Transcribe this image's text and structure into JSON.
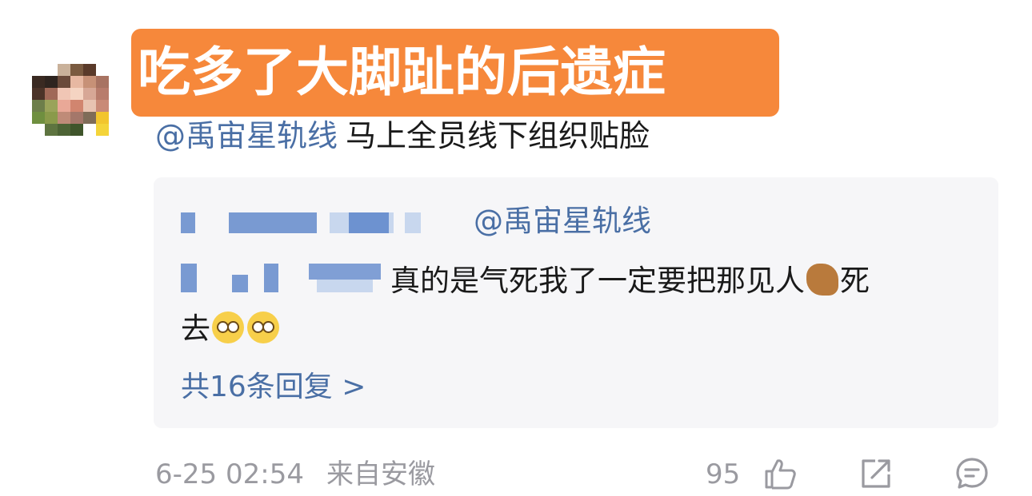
{
  "overlay_title": "吃多了大脚趾的后遗症",
  "comment": {
    "mention": "@禹宙星轨线",
    "text": "马上全员线下组织贴脸"
  },
  "reply": {
    "mention": "@禹宙星轨线",
    "text": "真的是气死我了一定要把那见人",
    "text_after_emoji": "死",
    "line2": "去",
    "reply_count_label": "共16条回复 >"
  },
  "meta": {
    "time": "6-25 02:54",
    "from": "来自安徽",
    "like_count": "95"
  },
  "icons": {
    "like": "thumbs-up-icon",
    "share": "share-icon",
    "comment": "comment-icon",
    "horse": "horse-emoji",
    "face": "rolling-eyes-emoji"
  },
  "colors": {
    "accent_blue": "#4a6fa5",
    "banner_orange": "#f6883b",
    "meta_gray": "#9a9aa0"
  }
}
